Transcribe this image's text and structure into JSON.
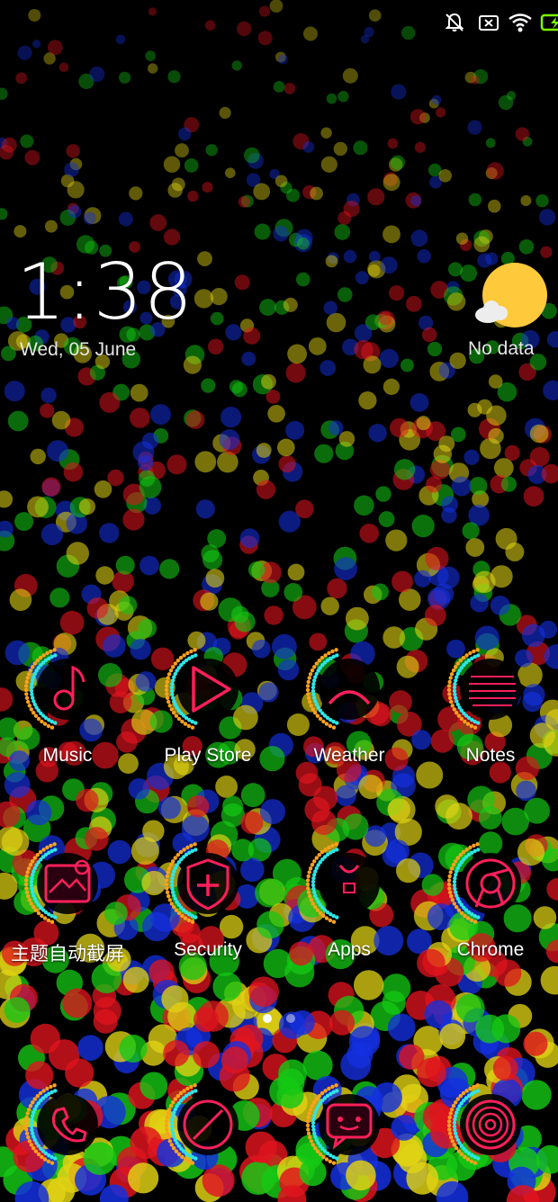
{
  "status_bar": {
    "icons": [
      "bell-muted-icon",
      "sim-error-icon",
      "wifi-icon",
      "battery-charging-icon"
    ],
    "accent": "#7CFC00"
  },
  "clock": {
    "time": "1:38",
    "date": "Wed, 05 June"
  },
  "weather": {
    "status": "No data",
    "sun_color": "#FFC93C",
    "cloud_color": "#EDEDED"
  },
  "apps": [
    {
      "name": "Music",
      "icon": "music-note-icon"
    },
    {
      "name": "Play Store",
      "icon": "play-triangle-icon"
    },
    {
      "name": "Weather",
      "icon": "weather-arc-icon"
    },
    {
      "name": "Notes",
      "icon": "notes-lines-icon"
    },
    {
      "name": "主题自动截屏",
      "icon": "screenshot-icon"
    },
    {
      "name": "Security",
      "icon": "shield-plus-icon"
    },
    {
      "name": "Apps",
      "icon": "bag-icon"
    },
    {
      "name": "Chrome",
      "icon": "chrome-icon"
    }
  ],
  "dock": [
    {
      "icon": "phone-icon"
    },
    {
      "icon": "compass-icon"
    },
    {
      "icon": "message-icon"
    },
    {
      "icon": "camera-lens-icon"
    }
  ],
  "page_indicator": {
    "pages": 2,
    "current": 1
  },
  "theme": {
    "icon_stroke": "#FF1F5A",
    "ring_inner": "#2EE6E6",
    "ring_outer": "#FFA11C"
  }
}
